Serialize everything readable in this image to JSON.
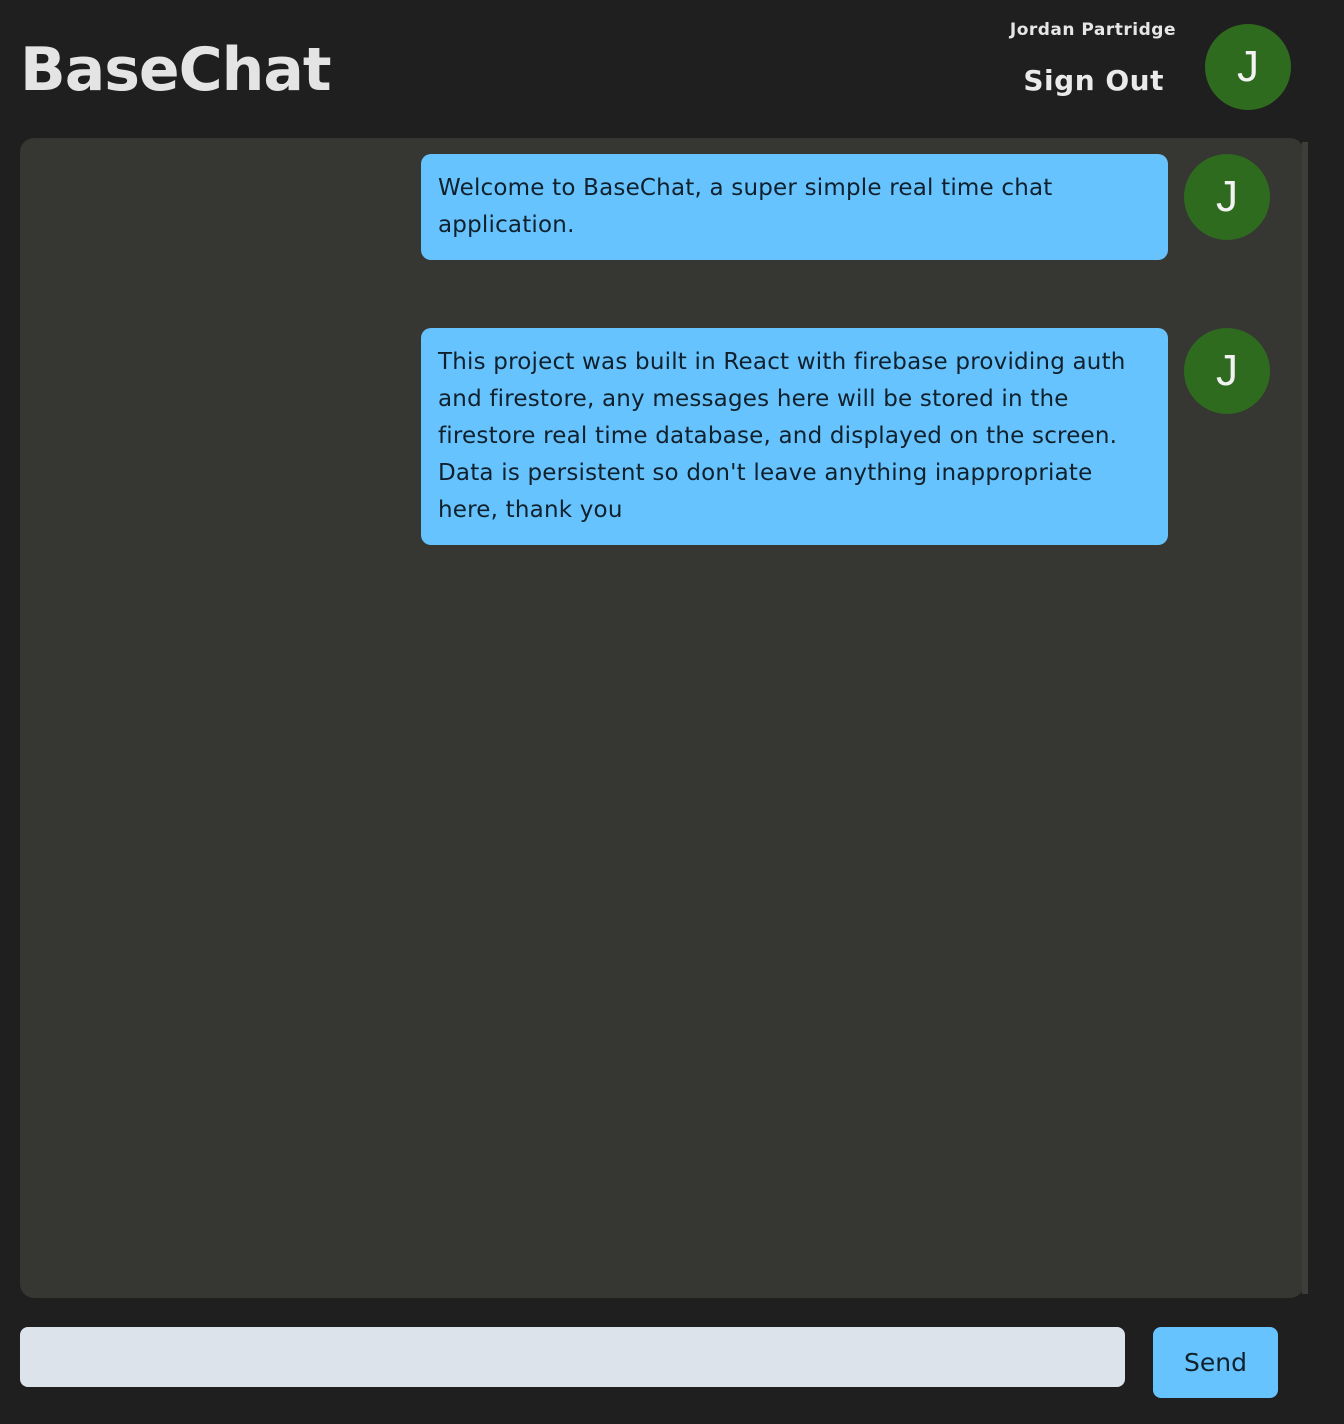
{
  "header": {
    "brand": "BaseChat",
    "user_name": "Jordan Partridge",
    "sign_out_label": "Sign Out",
    "avatar_initial": "J"
  },
  "messages": [
    {
      "text": "Welcome to BaseChat, a super simple real time chat application.",
      "avatar_initial": "J"
    },
    {
      "text": "This project was built in React with firebase providing auth and firestore, any messages here will be stored in the firestore real time database, and displayed on the screen. Data is persistent so don't leave anything inappropriate here, thank you",
      "avatar_initial": "J"
    }
  ],
  "composer": {
    "value": "",
    "placeholder": "",
    "send_label": "Send"
  },
  "colors": {
    "background": "#1f1f1f",
    "panel": "#363633",
    "bubble": "#66c3fd",
    "avatar": "#2e6b1f",
    "input": "#dde3ea"
  }
}
